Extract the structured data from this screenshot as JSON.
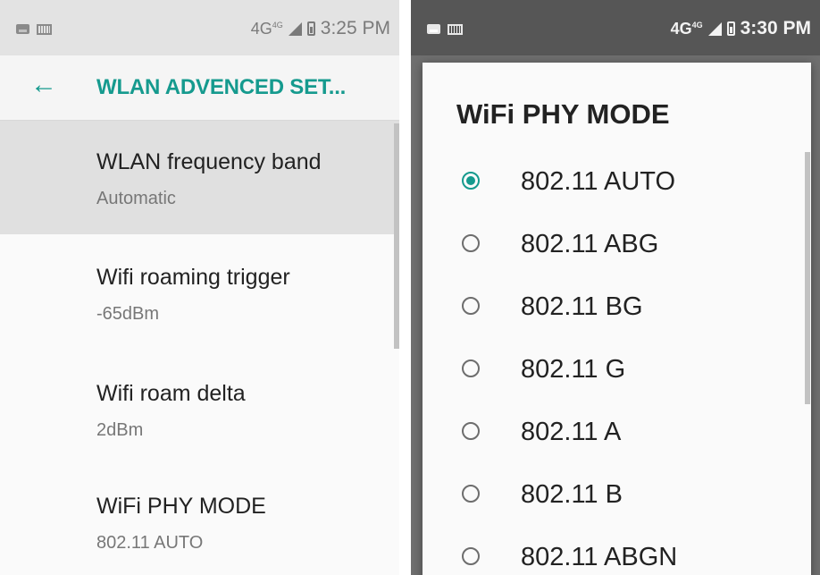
{
  "left": {
    "status_bar": {
      "network": "4G",
      "network_sup": "4G",
      "time": "3:25 PM"
    },
    "appbar": {
      "title": "WLAN ADVENCED SET..."
    },
    "preferences": [
      {
        "title": "WLAN frequency band",
        "summary": "Automatic"
      },
      {
        "title": "Wifi roaming trigger",
        "summary": "-65dBm"
      },
      {
        "title": "Wifi roam delta",
        "summary": "2dBm"
      },
      {
        "title": "WiFi PHY MODE",
        "summary": "802.11 AUTO"
      }
    ]
  },
  "right": {
    "status_bar": {
      "network": "4G",
      "network_sup": "4G",
      "time": "3:30 PM"
    },
    "dialog": {
      "title": "WiFi PHY MODE",
      "options": [
        {
          "label": "802.11 AUTO",
          "selected": true
        },
        {
          "label": "802.11 ABG",
          "selected": false
        },
        {
          "label": "802.11 BG",
          "selected": false
        },
        {
          "label": "802.11 G",
          "selected": false
        },
        {
          "label": "802.11 A",
          "selected": false
        },
        {
          "label": "802.11 B",
          "selected": false
        },
        {
          "label": "802.11 ABGN",
          "selected": false
        }
      ]
    }
  },
  "colors": {
    "accent": "#159a8e",
    "dim_background": "#6f6f6f"
  }
}
